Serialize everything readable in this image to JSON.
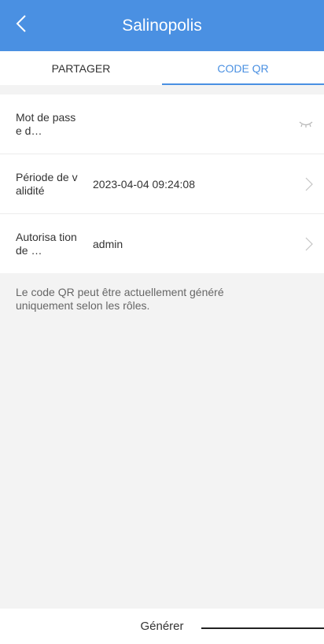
{
  "header": {
    "title": "Salinopolis",
    "back_icon": "chevron-left-icon",
    "background_color": "#4a90e2"
  },
  "tabs": [
    {
      "label": "PARTAGER",
      "active": false
    },
    {
      "label": "CODE QR",
      "active": true
    }
  ],
  "form": {
    "password": {
      "label": "Mot de passe d…",
      "value": "",
      "placeholder": "",
      "icon": "eye-closed-icon"
    },
    "validity": {
      "label": "Période de validité",
      "value": "2023-04-04 09:24:08",
      "icon": "chevron-right-icon"
    },
    "authorization": {
      "label": "Autorisa tion de …",
      "value": "admin",
      "icon": "chevron-right-icon"
    }
  },
  "note": "Le code QR peut être actuellement généré uniquement selon les rôles.",
  "footer": {
    "generate_label": "Générer"
  }
}
